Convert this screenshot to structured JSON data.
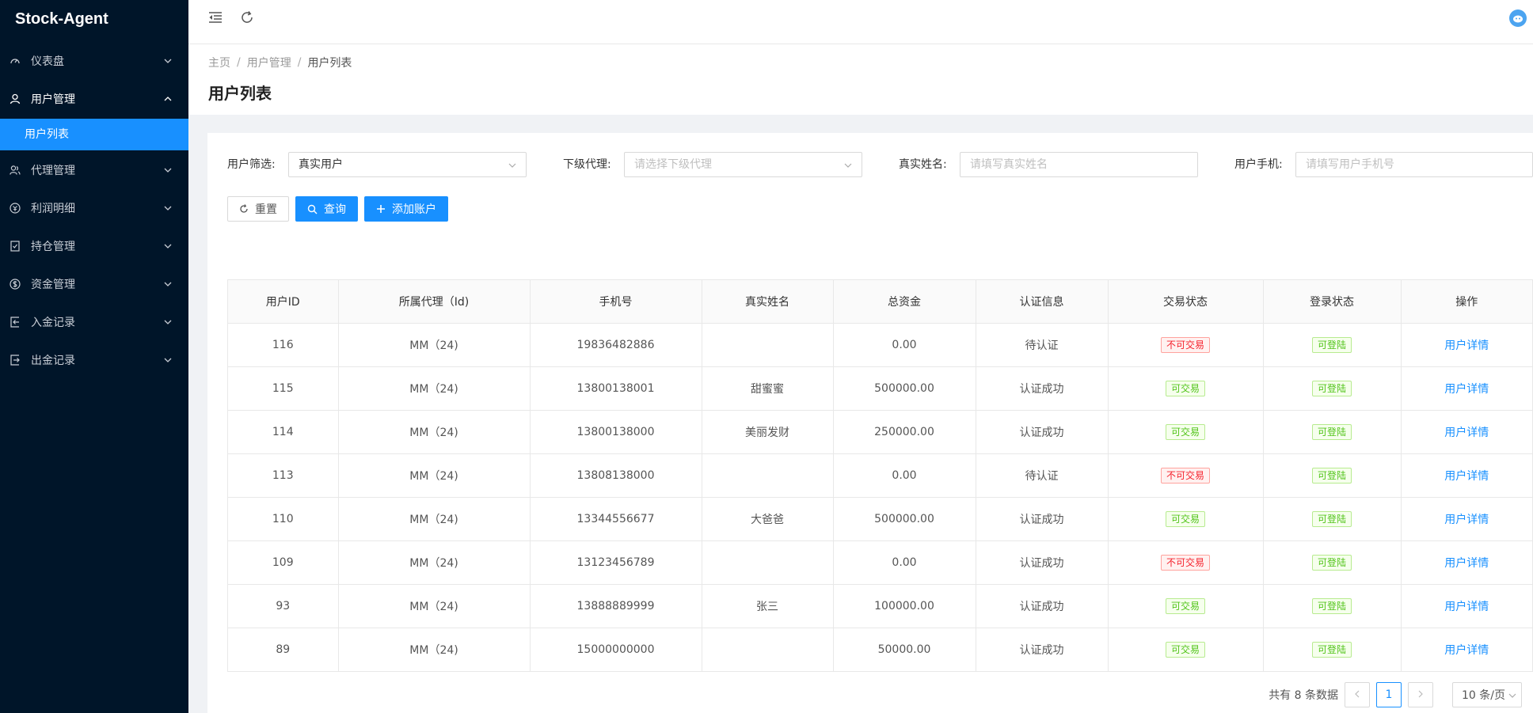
{
  "sidebar": {
    "brand": "Stock-Agent",
    "items": [
      {
        "label": "仪表盘",
        "icon": "dashboard-icon"
      },
      {
        "label": "用户管理",
        "icon": "user-icon",
        "open": true,
        "sub": [
          {
            "label": "用户列表",
            "active": true
          }
        ]
      },
      {
        "label": "代理管理",
        "icon": "agent-icon"
      },
      {
        "label": "利润明细",
        "icon": "profit-icon"
      },
      {
        "label": "持仓管理",
        "icon": "position-icon"
      },
      {
        "label": "资金管理",
        "icon": "fund-icon"
      },
      {
        "label": "入金记录",
        "icon": "deposit-icon"
      },
      {
        "label": "出金记录",
        "icon": "withdraw-icon"
      }
    ]
  },
  "breadcrumb": [
    "主页",
    "用户管理",
    "用户列表"
  ],
  "page_title": "用户列表",
  "filters": {
    "user_filter": {
      "label": "用户筛选:",
      "value": "真实用户"
    },
    "sub_agent": {
      "label": "下级代理:",
      "placeholder": "请选择下级代理"
    },
    "real_name": {
      "label": "真实姓名:",
      "placeholder": "请填写真实姓名"
    },
    "phone": {
      "label": "用户手机:",
      "placeholder": "请填写用户手机号"
    }
  },
  "actions": {
    "reset": "重置",
    "search": "查询",
    "add": "添加账户"
  },
  "table": {
    "columns": [
      "用户ID",
      "所属代理（Id)",
      "手机号",
      "真实姓名",
      "总资金",
      "认证信息",
      "交易状态",
      "登录状态",
      "操作"
    ],
    "rows": [
      {
        "id": "116",
        "agent": "MM（24)",
        "phone": "19836482886",
        "name": "",
        "funds": "0.00",
        "auth": "待认证",
        "trade": "不可交易",
        "trade_ok": false,
        "login": "可登陆",
        "action": "用户详情"
      },
      {
        "id": "115",
        "agent": "MM（24)",
        "phone": "13800138001",
        "name": "甜蜜蜜",
        "funds": "500000.00",
        "auth": "认证成功",
        "trade": "可交易",
        "trade_ok": true,
        "login": "可登陆",
        "action": "用户详情"
      },
      {
        "id": "114",
        "agent": "MM（24)",
        "phone": "13800138000",
        "name": "美丽发财",
        "funds": "250000.00",
        "auth": "认证成功",
        "trade": "可交易",
        "trade_ok": true,
        "login": "可登陆",
        "action": "用户详情"
      },
      {
        "id": "113",
        "agent": "MM（24)",
        "phone": "13808138000",
        "name": "",
        "funds": "0.00",
        "auth": "待认证",
        "trade": "不可交易",
        "trade_ok": false,
        "login": "可登陆",
        "action": "用户详情"
      },
      {
        "id": "110",
        "agent": "MM（24)",
        "phone": "13344556677",
        "name": "大爸爸",
        "funds": "500000.00",
        "auth": "认证成功",
        "trade": "可交易",
        "trade_ok": true,
        "login": "可登陆",
        "action": "用户详情"
      },
      {
        "id": "109",
        "agent": "MM（24)",
        "phone": "13123456789",
        "name": "",
        "funds": "0.00",
        "auth": "认证成功",
        "trade": "不可交易",
        "trade_ok": false,
        "login": "可登陆",
        "action": "用户详情"
      },
      {
        "id": "93",
        "agent": "MM（24)",
        "phone": "13888889999",
        "name": "张三",
        "funds": "100000.00",
        "auth": "认证成功",
        "trade": "可交易",
        "trade_ok": true,
        "login": "可登陆",
        "action": "用户详情"
      },
      {
        "id": "89",
        "agent": "MM（24)",
        "phone": "15000000000",
        "name": "",
        "funds": "50000.00",
        "auth": "认证成功",
        "trade": "可交易",
        "trade_ok": true,
        "login": "可登陆",
        "action": "用户详情"
      }
    ]
  },
  "pagination": {
    "total": "共有 8 条数据",
    "current": "1",
    "page_size": "10 条/页"
  },
  "colors": {
    "sidebar_bg": "#001529",
    "accent": "#1890ff",
    "success": "#52c41a",
    "danger": "#f5222d"
  }
}
